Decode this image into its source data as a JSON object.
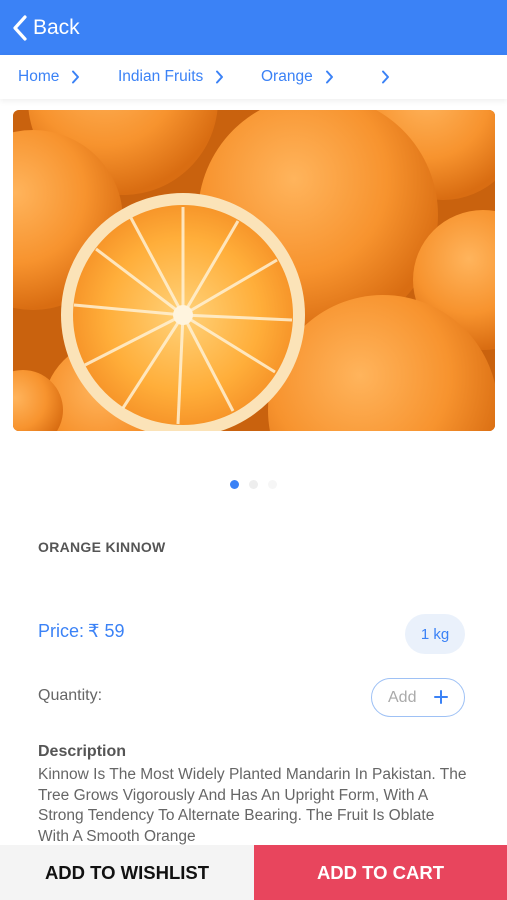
{
  "header": {
    "back_label": "Back",
    "color": "#3b82f6"
  },
  "breadcrumb": {
    "items": [
      "Home",
      "Indian Fruits",
      "Orange",
      ""
    ],
    "separator_icon": "chevron-right-icon"
  },
  "hero": {
    "image_description_icon": "product-image",
    "slides": 3,
    "active_slide": 1
  },
  "product": {
    "name": "ORANGE KINNOW",
    "price_label": "Price:",
    "price_value": "₹ 59",
    "weight": "1 kg",
    "quantity_label": "Quantity:",
    "add_label": "Add",
    "description_heading": "Description",
    "description": "Kinnow Is The Most Widely Planted Mandarin In Pakistan. The Tree Grows Vigorously And Has An Upright Form, With A Strong Tendency To Alternate Bearing. The Fruit Is Oblate With A Smooth Orange"
  },
  "actions": {
    "wishlist_label": "ADD TO WISHLIST",
    "cart_label": "ADD TO CART",
    "cart_color": "#e8455d"
  }
}
